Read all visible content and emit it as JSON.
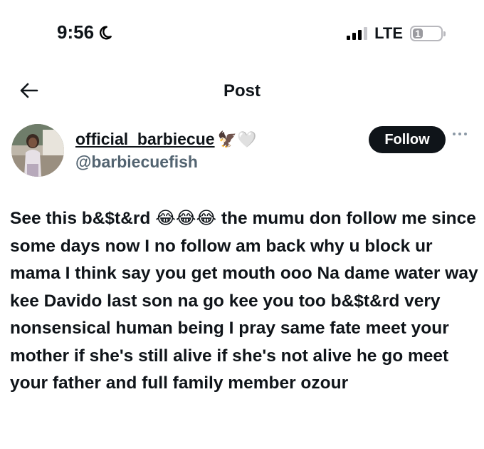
{
  "status_bar": {
    "time": "9:56",
    "network": "LTE",
    "battery_level": "1"
  },
  "header": {
    "title": "Post"
  },
  "author": {
    "display_name": "official_barbiecue",
    "handle": "@barbiecuefish",
    "name_emojis": "🦅🤍"
  },
  "actions": {
    "follow_label": "Follow"
  },
  "post": {
    "text": "See this b&$t&rd 😂😂😂 the mumu don follow me since some days now I no follow am back why u block ur mama I think say you get mouth ooo Na dame water way kee Davido last son na go kee you too b&$t&rd very nonsensical human being I pray same fate meet your mother if she's still alive if she's not alive he go meet your father and full family member ozour"
  },
  "icons": {
    "moon": "moon-icon",
    "signal": "signal-icon",
    "battery": "battery-icon",
    "back": "arrow-left-icon",
    "more": "more-horizontal-icon"
  },
  "colors": {
    "text_primary": "#0f1419",
    "text_secondary": "#536471",
    "follow_bg": "#0f1419",
    "follow_text": "#ffffff"
  }
}
